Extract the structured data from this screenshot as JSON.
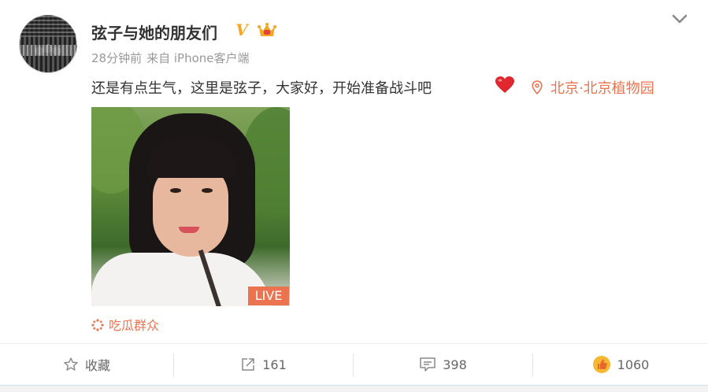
{
  "post": {
    "username": "弦子与她的朋友们",
    "verified_badge": "V",
    "time": "28分钟前",
    "source": "来自 iPhone客户端",
    "text": "还是有点生气，这里是弦子，大家好，开始准备战斗吧",
    "location": "北京·北京植物园",
    "media_badge": "LIVE",
    "topic": "吃瓜群众"
  },
  "icons": {
    "menu": "chevron-down-icon",
    "verified": "verified-v-icon",
    "member": "crown-icon",
    "emoji": "red-heart-icon",
    "location": "location-pin-icon",
    "topic": "spark-icon",
    "favorite": "star-icon",
    "repost": "share-icon",
    "comment": "comment-icon",
    "like": "thumbs-up-icon"
  },
  "actions": {
    "favorite_label": "收藏",
    "repost_count": "161",
    "comment_count": "398",
    "like_count": "1060"
  },
  "colors": {
    "accent": "#eb7350",
    "verified": "#f5a623",
    "text": "#333333",
    "muted": "#999999"
  }
}
